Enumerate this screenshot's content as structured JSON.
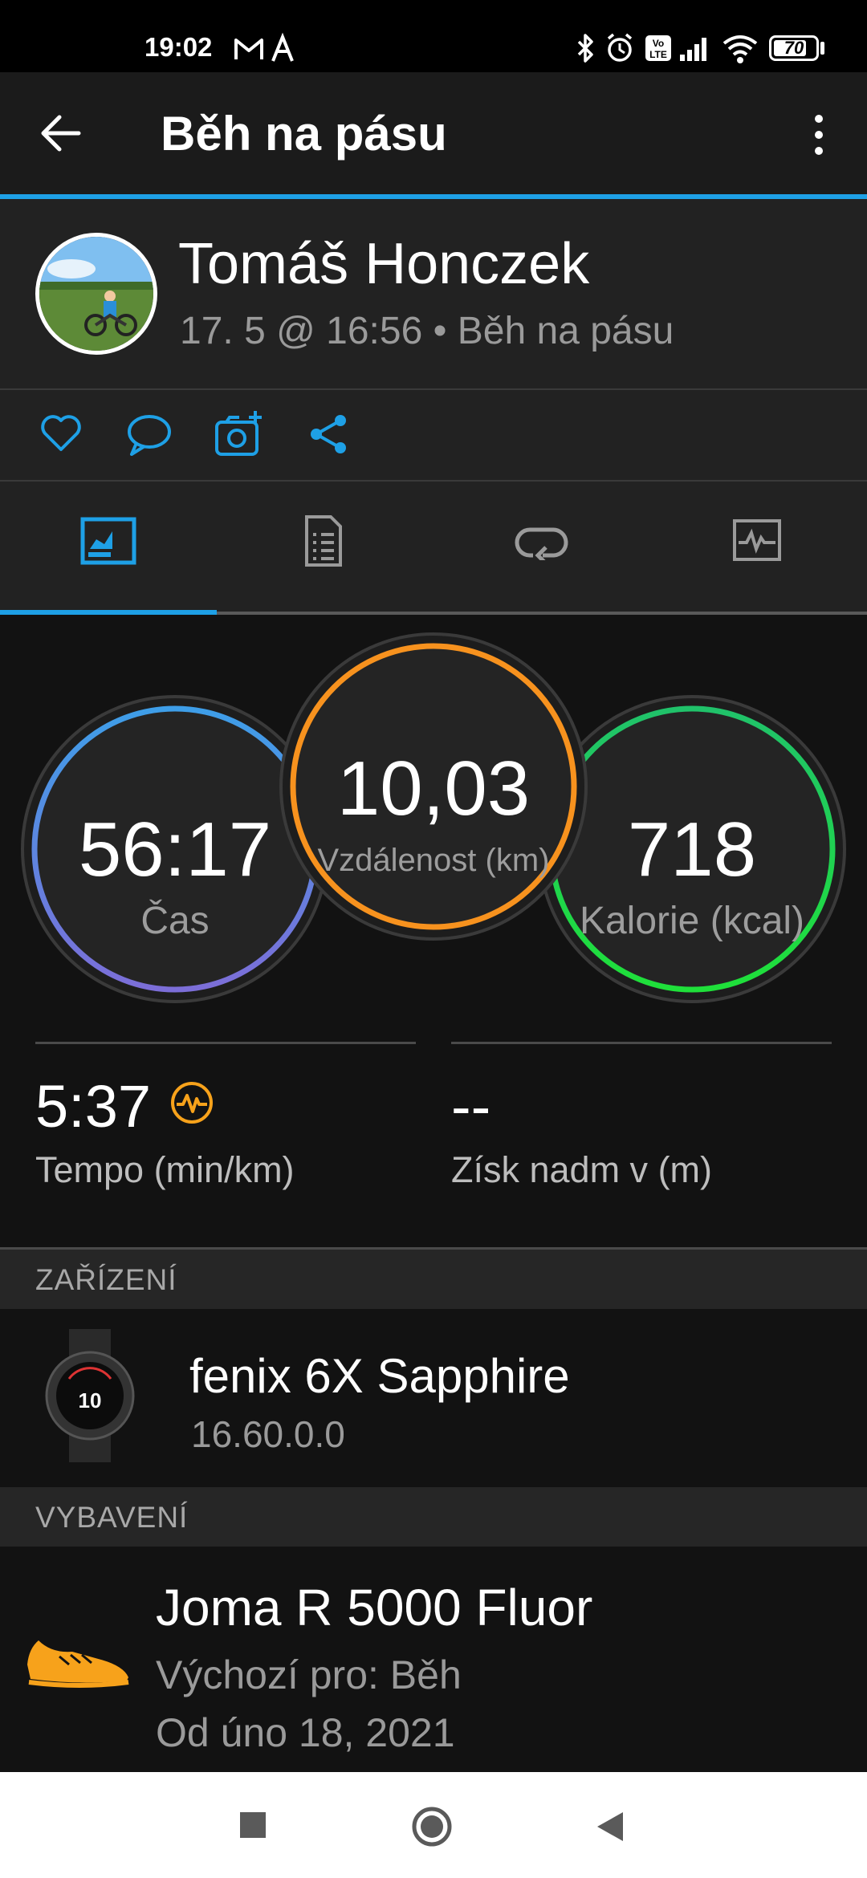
{
  "status_bar": {
    "time": "19:02",
    "battery": "70"
  },
  "app_bar": {
    "title": "Běh na pásu"
  },
  "activity": {
    "user_name": "Tomáš Honczek",
    "subtitle": "17. 5 @ 16:56 • Běh na pásu"
  },
  "metrics": {
    "time": {
      "value": "56:17",
      "label": "Čas"
    },
    "distance": {
      "value": "10,03",
      "label": "Vzdálenost (km)"
    },
    "calories": {
      "value": "718",
      "label": "Kalorie (kcal)"
    }
  },
  "stats": {
    "pace": {
      "value": "5:37",
      "label": "Tempo (min/km)"
    },
    "elevation": {
      "value": "--",
      "label": "Získ nadm v (m)"
    }
  },
  "device_section": {
    "title": "ZAŘÍZENÍ",
    "name": "fenix 6X Sapphire",
    "version": "16.60.0.0",
    "watch_face_number": "10"
  },
  "gear_section": {
    "title": "VYBAVENÍ",
    "name": "Joma R 5000 Fluor",
    "default_for": "Výchozí pro: Běh",
    "since": "Od úno 18, 2021"
  },
  "colors": {
    "accent": "#1ea0e6",
    "time_ring": "#5b8be0",
    "distance_ring": "#f7921e",
    "calories_ring": "#1fd34a",
    "shoe": "#f7a21b"
  }
}
